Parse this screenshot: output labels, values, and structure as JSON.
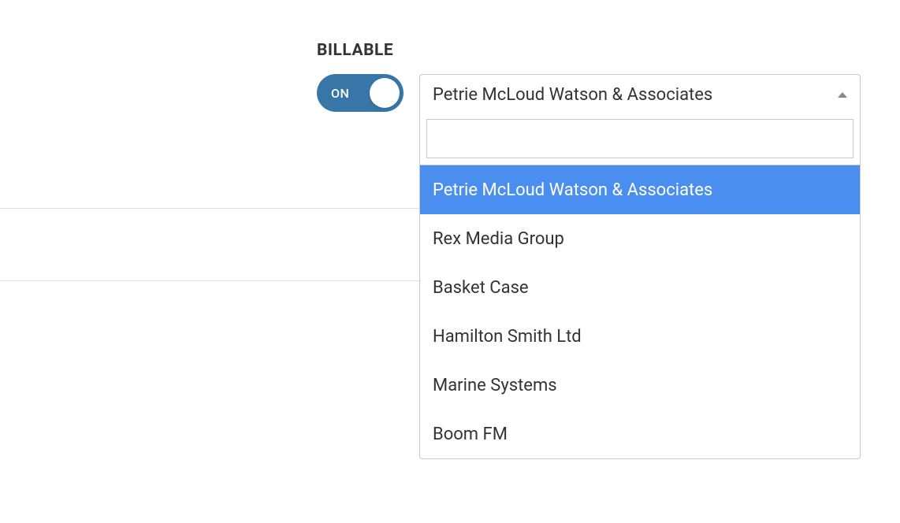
{
  "billable": {
    "label": "BILLABLE",
    "toggle_state": "ON"
  },
  "dropdown": {
    "selected": "Petrie McLoud Watson & Associates",
    "search_value": "",
    "options": [
      {
        "label": "Petrie McLoud Watson & Associates",
        "selected": true
      },
      {
        "label": "Rex Media Group",
        "selected": false
      },
      {
        "label": "Basket Case",
        "selected": false
      },
      {
        "label": "Hamilton Smith Ltd",
        "selected": false
      },
      {
        "label": "Marine Systems",
        "selected": false
      },
      {
        "label": "Boom FM",
        "selected": false
      }
    ]
  }
}
